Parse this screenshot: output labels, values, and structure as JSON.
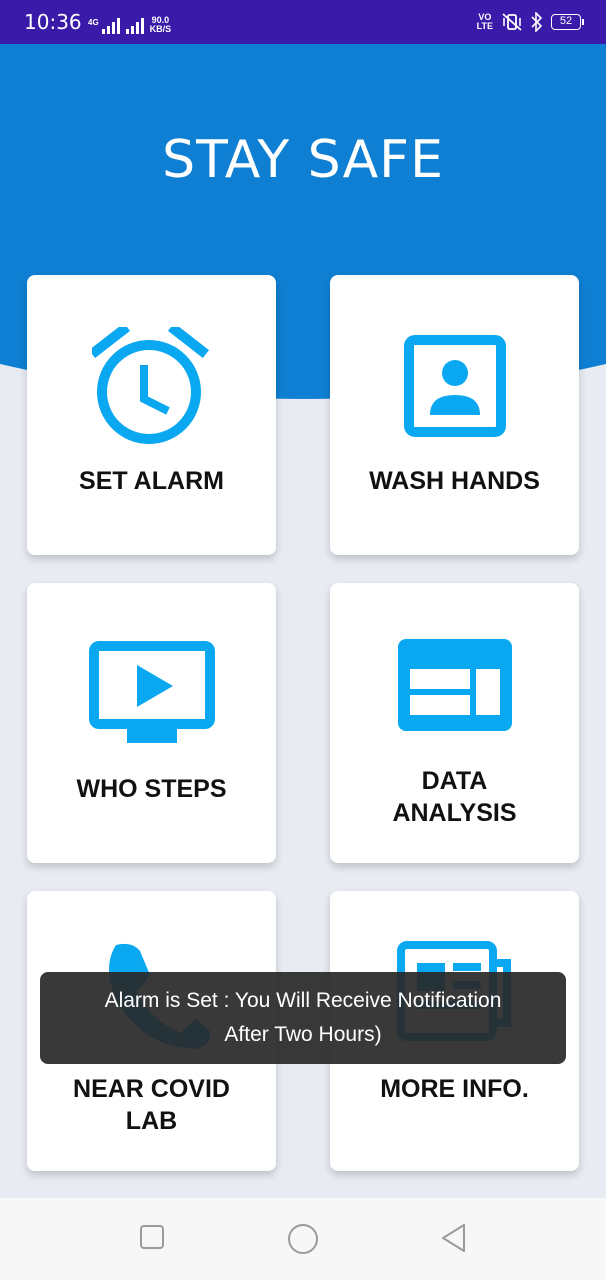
{
  "status_bar": {
    "time": "10:36",
    "network_label": "4G",
    "net_speed_value": "90.0",
    "net_speed_unit": "KB/S",
    "volte_top": "VO",
    "volte_bottom": "LTE",
    "battery_level": "52"
  },
  "header": {
    "title": "STAY SAFE",
    "color": "#0f7fd3"
  },
  "cards": [
    {
      "label_line1": "SET ALARM",
      "label_line2": "",
      "icon": "alarm-clock-icon"
    },
    {
      "label_line1": "WASH HANDS",
      "label_line2": "",
      "icon": "account-box-icon"
    },
    {
      "label_line1": "WHO STEPS",
      "label_line2": "",
      "icon": "video-play-icon"
    },
    {
      "label_line1": "DATA",
      "label_line2": "ANALYSIS",
      "icon": "dashboard-icon"
    },
    {
      "label_line1": "NEAR COVID",
      "label_line2": "LAB",
      "icon": "phone-icon"
    },
    {
      "label_line1": "MORE INFO.",
      "label_line2": "",
      "icon": "news-icon"
    }
  ],
  "toast": {
    "line1": "Alarm is Set : You Will Receive Notification",
    "line2": "After Two Hours)"
  },
  "colors": {
    "icon_accent": "#0aa8f0",
    "status_bar": "#3a1aa8",
    "background": "#e8ecf2"
  }
}
